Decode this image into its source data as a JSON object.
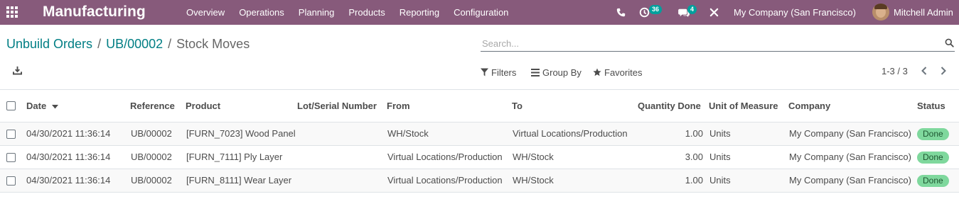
{
  "navbar": {
    "app_name": "Manufacturing",
    "menu": [
      "Overview",
      "Operations",
      "Planning",
      "Products",
      "Reporting",
      "Configuration"
    ],
    "activity_count": "36",
    "messages_count": "4",
    "company": "My Company (San Francisco)",
    "user": "Mitchell Admin"
  },
  "breadcrumb": {
    "items": [
      "Unbuild Orders",
      "UB/00002"
    ],
    "separator": "/",
    "current": "Stock Moves"
  },
  "search": {
    "placeholder": "Search...",
    "value": ""
  },
  "filters": {
    "filters_label": "Filters",
    "groupby_label": "Group By",
    "favorites_label": "Favorites"
  },
  "pager": {
    "text": "1-3 / 3"
  },
  "table": {
    "columns": {
      "date": "Date",
      "reference": "Reference",
      "product": "Product",
      "lot": "Lot/Serial Number",
      "from": "From",
      "to": "To",
      "qty": "Quantity Done",
      "uom": "Unit of Measure",
      "company": "Company",
      "status": "Status"
    },
    "rows": [
      {
        "date": "04/30/2021 11:36:14",
        "reference": "UB/00002",
        "product": "[FURN_7023] Wood Panel",
        "lot": "",
        "from": "WH/Stock",
        "to": "Virtual Locations/Production",
        "qty": "1.00",
        "uom": "Units",
        "company": "My Company (San Francisco)",
        "status": "Done"
      },
      {
        "date": "04/30/2021 11:36:14",
        "reference": "UB/00002",
        "product": "[FURN_7111] Ply Layer",
        "lot": "",
        "from": "Virtual Locations/Production",
        "to": "WH/Stock",
        "qty": "3.00",
        "uom": "Units",
        "company": "My Company (San Francisco)",
        "status": "Done"
      },
      {
        "date": "04/30/2021 11:36:14",
        "reference": "UB/00002",
        "product": "[FURN_8111] Wear Layer",
        "lot": "",
        "from": "Virtual Locations/Production",
        "to": "WH/Stock",
        "qty": "1.00",
        "uom": "Units",
        "company": "My Company (San Francisco)",
        "status": "Done"
      }
    ]
  },
  "colors": {
    "navbar": "#875a7b",
    "link": "#017e84",
    "badge": "#00a09d",
    "status_done": "#7fd89d"
  }
}
